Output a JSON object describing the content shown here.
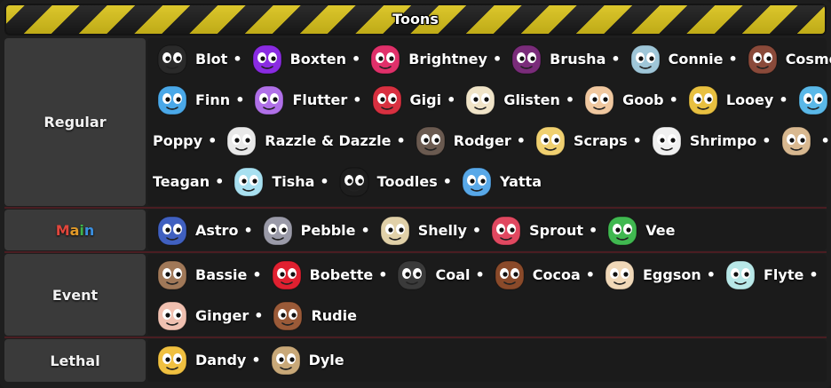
{
  "title": "Toons",
  "colors": {
    "stripe_yellow": "#d9c21a",
    "stripe_dark": "#1a1a1a",
    "label_bg": "#3a3a3a",
    "body_bg": "#1b1b1b",
    "separator": "#4a1d22"
  },
  "main_label_colors": [
    "#e0463c",
    "#e39a28",
    "#3fb54a",
    "#3a8fe0",
    "#8e4fd6"
  ],
  "sections": [
    {
      "label": "Regular",
      "lines": [
        [
          {
            "name": "Blot",
            "icon": "blot-portrait",
            "color": "#2a2a2a"
          },
          {
            "name": "Boxten",
            "icon": "boxten-portrait",
            "color": "#8a2be2"
          },
          {
            "name": "Brightney",
            "icon": "brightney-portrait",
            "color": "#e0306a"
          },
          {
            "name": "Brusha",
            "icon": "brusha-portrait",
            "color": "#7a2c7a"
          },
          {
            "name": "Connie",
            "icon": "connie-portrait",
            "color": "#9fc6d8"
          },
          {
            "name": "Cosmo",
            "icon": "cosmo-portrait",
            "color": "#8a4a3a"
          }
        ],
        [
          {
            "name": "Finn",
            "icon": "finn-portrait",
            "color": "#4aa8e8"
          },
          {
            "name": "Flutter",
            "icon": "flutter-portrait",
            "color": "#b070e8"
          },
          {
            "name": "Gigi",
            "icon": "gigi-portrait",
            "color": "#d83040"
          },
          {
            "name": "Glisten",
            "icon": "glisten-portrait",
            "color": "#f0e4c8"
          },
          {
            "name": "Goob",
            "icon": "goob-portrait",
            "color": "#f0c8a0"
          },
          {
            "name": "Looey",
            "icon": "looey-portrait",
            "color": "#e8c040"
          },
          {
            "name": "",
            "icon": "poppy-portrait",
            "color": "#5ab8e8"
          }
        ],
        [
          {
            "name": "Poppy",
            "icon": "",
            "color": ""
          },
          {
            "name": "Razzle & Dazzle",
            "icon": "razzle-dazzle-portrait",
            "color": "#e8e8e8"
          },
          {
            "name": "Rodger",
            "icon": "rodger-portrait",
            "color": "#6a5a50"
          },
          {
            "name": "Scraps",
            "icon": "scraps-portrait",
            "color": "#f0d070"
          },
          {
            "name": "Shrimpo",
            "icon": "shrimpo-portrait",
            "color": "#f0f0f0"
          },
          {
            "name": "",
            "icon": "teagan-portrait",
            "color": "#d8b890"
          }
        ],
        [
          {
            "name": "Teagan",
            "icon": "",
            "color": ""
          },
          {
            "name": "Tisha",
            "icon": "tisha-portrait",
            "color": "#a8e0f0"
          },
          {
            "name": "Toodles",
            "icon": "toodles-portrait",
            "color": "#1e1e1e"
          },
          {
            "name": "Yatta",
            "icon": "yatta-portrait",
            "color": "#58a8e8"
          }
        ]
      ]
    },
    {
      "label": "Main",
      "lines": [
        [
          {
            "name": "Astro",
            "icon": "astro-portrait",
            "color": "#4060c0"
          },
          {
            "name": "Pebble",
            "icon": "pebble-portrait",
            "color": "#9a9aa8"
          },
          {
            "name": "Shelly",
            "icon": "shelly-portrait",
            "color": "#e0d0a8"
          },
          {
            "name": "Sprout",
            "icon": "sprout-portrait",
            "color": "#e04860"
          },
          {
            "name": "Vee",
            "icon": "vee-portrait",
            "color": "#40b850"
          }
        ]
      ]
    },
    {
      "label": "Event",
      "lines": [
        [
          {
            "name": "Bassie",
            "icon": "bassie-portrait",
            "color": "#a07858"
          },
          {
            "name": "Bobette",
            "icon": "bobette-portrait",
            "color": "#e02030"
          },
          {
            "name": "Coal",
            "icon": "coal-portrait",
            "color": "#3a3a3a"
          },
          {
            "name": "Cocoa",
            "icon": "cocoa-portrait",
            "color": "#8a4a2a"
          },
          {
            "name": "Eggson",
            "icon": "eggson-portrait",
            "color": "#f0d8b8"
          },
          {
            "name": "Flyte",
            "icon": "flyte-portrait",
            "color": "#b8e8e8"
          }
        ],
        [
          {
            "name": "Ginger",
            "icon": "ginger-portrait",
            "color": "#f0c0b0"
          },
          {
            "name": "Rudie",
            "icon": "rudie-portrait",
            "color": "#9a5a38"
          }
        ]
      ]
    },
    {
      "label": "Lethal",
      "lines": [
        [
          {
            "name": "Dandy",
            "icon": "dandy-portrait",
            "color": "#f0c040"
          },
          {
            "name": "Dyle",
            "icon": "dyle-portrait",
            "color": "#c8a878"
          }
        ]
      ]
    }
  ]
}
